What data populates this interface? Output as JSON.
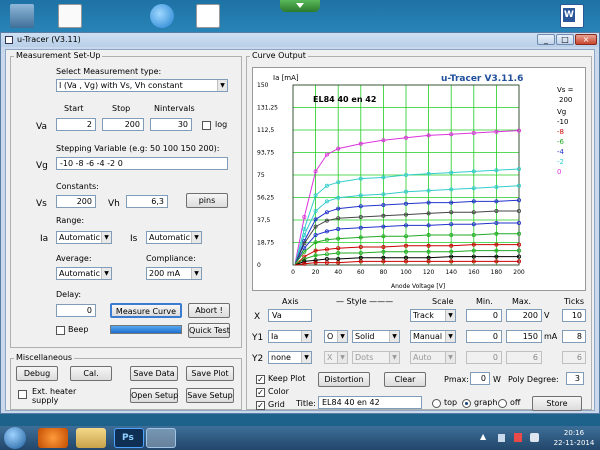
{
  "window": {
    "title": "u-Tracer (V3.11)",
    "controls": [
      "_",
      "□",
      "×"
    ]
  },
  "setup": {
    "group_label": "Measurement Set-Up",
    "type_label": "Select Measurement type:",
    "type_value": "I (Va , Vg) with Vs, Vh constant",
    "col_start": "Start",
    "col_stop": "Stop",
    "col_n": "Nintervals",
    "va_label": "Va",
    "va_start": "2",
    "va_stop": "200",
    "va_n": "30",
    "log_label": "log",
    "step_label": "Stepping Variable (e.g: 50 100 150 200):",
    "vg_label": "Vg",
    "vg_value": "-10 -8 -6 -4 -2 0",
    "constants_label": "Constants:",
    "vs_label": "Vs",
    "vs_value": "200",
    "vh_label": "Vh",
    "vh_value": "6,3",
    "pins": "pins",
    "range_label": "Range:",
    "ia_label": "Ia",
    "ia_range": "Automatic",
    "is_label": "Is",
    "is_range": "Automatic",
    "average_label": "Average:",
    "average_value": "Automatic",
    "compliance_label": "Compliance:",
    "compliance_value": "200 mA",
    "delay_label": "Delay:",
    "delay_value": "0",
    "measure": "Measure Curve",
    "abort": "Abort !",
    "beep": "Beep",
    "quicktest": "Quick Test"
  },
  "misc": {
    "group_label": "Miscellaneous",
    "debug": "Debug",
    "cal": "Cal.",
    "save_data": "Save Data",
    "save_plot": "Save Plot",
    "ext_heater": "Ext. heater supply",
    "open_setup": "Open Setup",
    "save_setup": "Save Setup"
  },
  "curve": {
    "group_label": "Curve Output",
    "axes_hdr": {
      "axis": "Axis",
      "style": "Style",
      "scale": "Scale",
      "min": "Min.",
      "max": "Max.",
      "ticks": "Ticks"
    },
    "rows": [
      {
        "name": "X",
        "var": "Va",
        "scale": "Track",
        "min": "0",
        "max": "200",
        "unit": "V",
        "ticks": "10"
      },
      {
        "name": "Y1",
        "var": "Ia",
        "marker": "O",
        "line": "Solid",
        "scale": "Manual",
        "min": "0",
        "max": "150",
        "unit": "mA",
        "ticks": "8"
      },
      {
        "name": "Y2",
        "var": "none",
        "marker": "X",
        "line": "Dots",
        "scale": "Auto",
        "min": "0",
        "max": "6",
        "unit": "",
        "ticks": "6"
      }
    ],
    "keep_plot": "Keep Plot",
    "color": "Color",
    "grid": "Grid",
    "distortion": "Distortion",
    "clear": "Clear",
    "pmax_label": "Pmax:",
    "pmax_value": "0",
    "pmax_unit": "W",
    "poly_label": "Poly Degree:",
    "poly_value": "3",
    "title_label": "Title:",
    "title_value": "EL84 40 en 42",
    "pos_top": "top",
    "pos_graph": "graph",
    "pos_off": "off",
    "store": "Store"
  },
  "plot": {
    "brand": "u-Tracer V3.11.6",
    "chart_title": "EL84 40 en 42",
    "ylabel": "Ia [mA]",
    "xlabel": "Anode Voltage [V]",
    "vs_label": "Vs =",
    "vs_value": "200",
    "vg_header": "Vg",
    "legend": [
      {
        "label": "-10",
        "color": "#000000"
      },
      {
        "label": "-8",
        "color": "#cc0000"
      },
      {
        "label": "-6",
        "color": "#22aa22"
      },
      {
        "label": "-4",
        "color": "#2233cc"
      },
      {
        "label": "-2",
        "color": "#33cccc"
      },
      {
        "label": "0",
        "color": "#dd33dd"
      }
    ]
  },
  "chart_data": {
    "type": "line",
    "title": "EL84 40 en 42",
    "xlabel": "Anode Voltage [V]",
    "ylabel": "Ia [mA]",
    "xlim": [
      0,
      200
    ],
    "ylim": [
      0,
      150
    ],
    "x_ticks": [
      0,
      20,
      40,
      60,
      80,
      100,
      120,
      140,
      160,
      180,
      200
    ],
    "y_ticks": [
      "0",
      "18,75",
      "37,5",
      "56,25",
      "75",
      "93,75",
      "112,5",
      "131,25",
      "150"
    ],
    "grid": true,
    "legend_position": "right",
    "series": [
      {
        "name": "0",
        "color": "#dd33dd",
        "x": [
          2,
          10,
          20,
          30,
          40,
          60,
          80,
          100,
          120,
          140,
          160,
          180,
          200
        ],
        "y": [
          2,
          40,
          78,
          92,
          97,
          101,
          104,
          106,
          108,
          109,
          110,
          111,
          112
        ]
      },
      {
        "name": "0",
        "color": "#33cccc",
        "x": [
          2,
          10,
          20,
          30,
          40,
          60,
          80,
          100,
          120,
          140,
          160,
          180,
          200
        ],
        "y": [
          1,
          30,
          58,
          66,
          69,
          72,
          73,
          75,
          76,
          77,
          78,
          79,
          80
        ]
      },
      {
        "name": "-2",
        "color": "#33cccc",
        "x": [
          2,
          10,
          20,
          30,
          40,
          60,
          80,
          100,
          120,
          140,
          160,
          180,
          200
        ],
        "y": [
          1,
          25,
          45,
          53,
          56,
          58,
          59,
          61,
          62,
          63,
          64,
          65,
          66
        ]
      },
      {
        "name": "-4",
        "color": "#2233cc",
        "x": [
          2,
          10,
          20,
          30,
          40,
          60,
          80,
          100,
          120,
          140,
          160,
          180,
          200
        ],
        "y": [
          1,
          20,
          38,
          44,
          47,
          49,
          50,
          51,
          52,
          52,
          53,
          53,
          54
        ]
      },
      {
        "name": "-4",
        "color": "#444444",
        "x": [
          2,
          10,
          20,
          30,
          40,
          60,
          80,
          100,
          120,
          140,
          160,
          180,
          200
        ],
        "y": [
          1,
          18,
          32,
          37,
          39,
          40,
          41,
          42,
          43,
          44,
          44,
          45,
          45
        ]
      },
      {
        "name": "-6",
        "color": "#2233cc",
        "x": [
          2,
          10,
          20,
          30,
          40,
          60,
          80,
          100,
          120,
          140,
          160,
          180,
          200
        ],
        "y": [
          1,
          14,
          25,
          28,
          30,
          31,
          32,
          33,
          33,
          34,
          34,
          35,
          35
        ]
      },
      {
        "name": "-6",
        "color": "#22aa22",
        "x": [
          2,
          10,
          20,
          30,
          40,
          60,
          80,
          100,
          120,
          140,
          160,
          180,
          200
        ],
        "y": [
          1,
          11,
          19,
          21,
          22,
          23,
          24,
          24,
          25,
          25,
          25,
          26,
          26
        ]
      },
      {
        "name": "-8",
        "color": "#cc0000",
        "x": [
          2,
          10,
          20,
          30,
          40,
          60,
          80,
          100,
          120,
          140,
          160,
          180,
          200
        ],
        "y": [
          0,
          7,
          12,
          13,
          14,
          15,
          15,
          16,
          16,
          16,
          17,
          17,
          17
        ]
      },
      {
        "name": "-8",
        "color": "#22aa22",
        "x": [
          2,
          10,
          20,
          30,
          40,
          60,
          80,
          100,
          120,
          140,
          160,
          180,
          200
        ],
        "y": [
          0,
          5,
          8,
          9,
          10,
          10,
          11,
          11,
          11,
          11,
          12,
          12,
          12
        ]
      },
      {
        "name": "-10",
        "color": "#000000",
        "x": [
          2,
          10,
          20,
          30,
          40,
          60,
          80,
          100,
          120,
          140,
          160,
          180,
          200
        ],
        "y": [
          0,
          3,
          4,
          5,
          5,
          6,
          6,
          6,
          6,
          7,
          7,
          7,
          7
        ]
      },
      {
        "name": "-10",
        "color": "#cc0000",
        "x": [
          2,
          10,
          20,
          30,
          40,
          60,
          80,
          100,
          120,
          140,
          160,
          180,
          200
        ],
        "y": [
          0,
          1,
          2,
          2,
          2,
          3,
          3,
          3,
          3,
          3,
          3,
          3,
          3
        ]
      }
    ]
  },
  "taskbar": {
    "time": "20:16",
    "date": "22-11-2014",
    "apps": [
      "start",
      "media-player",
      "explorer",
      "photoshop",
      "utracer"
    ]
  },
  "desktop": {
    "icons": [
      "computer",
      "document",
      "internet-explorer",
      "checklist",
      "word"
    ]
  },
  "colors": {
    "accent": "#1f4e9c",
    "plot_grid": "#22cc22"
  }
}
